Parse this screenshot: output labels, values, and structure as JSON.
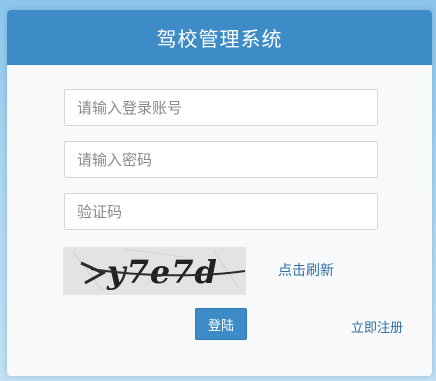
{
  "header": {
    "title": "驾校管理系统"
  },
  "form": {
    "account": {
      "placeholder": "请输入登录账号",
      "value": ""
    },
    "password": {
      "placeholder": "请输入密码",
      "value": ""
    },
    "captcha": {
      "placeholder": "验证码",
      "value": ""
    }
  },
  "captcha_image": {
    "text": "y7e7d"
  },
  "links": {
    "refresh": "点击刷新",
    "register": "立即注册"
  },
  "buttons": {
    "login": "登陆"
  },
  "colors": {
    "header": "#3d8cc8",
    "background": "#a9d5f1",
    "link": "#2f6fa6"
  }
}
